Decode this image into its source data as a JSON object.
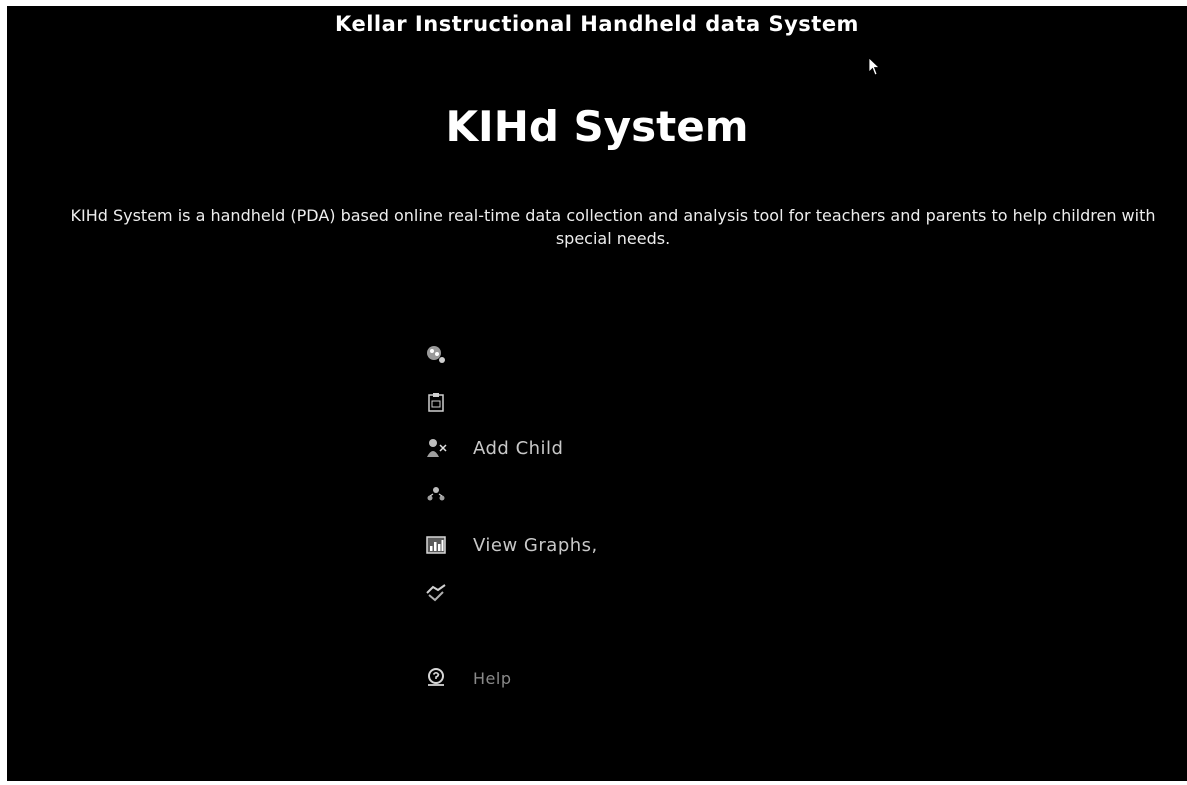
{
  "header": {
    "title": "Kellar Instructional Handheld data System"
  },
  "main": {
    "heading": "KIHd System",
    "description": "KIHd System is a handheld (PDA) based online real-time data collection and analysis tool for teachers and parents to help children with special needs."
  },
  "menu": {
    "items": [
      {
        "label": "",
        "icon": "people-icon"
      },
      {
        "label": "",
        "icon": "clipboard-icon"
      },
      {
        "label": "Add Child",
        "icon": "add-child-icon"
      },
      {
        "label": "",
        "icon": "group-icon"
      },
      {
        "label": "View Graphs,",
        "icon": "chart-icon"
      },
      {
        "label": "",
        "icon": "handshake-icon"
      },
      {
        "label": "Help",
        "icon": "help-icon"
      }
    ]
  },
  "colors": {
    "background": "#000000",
    "text": "#ffffff",
    "menu_text": "#c8c8c8"
  }
}
